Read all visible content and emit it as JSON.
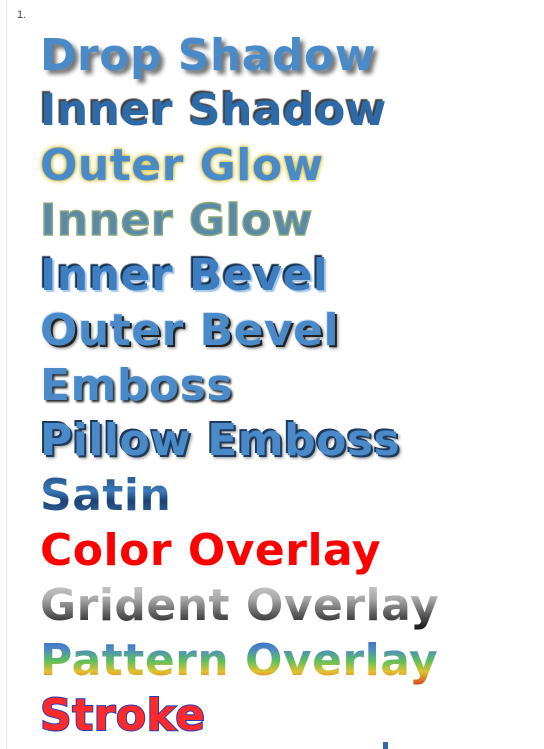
{
  "list": {
    "marker": "1."
  },
  "effects": [
    {
      "label": "Drop Shadow",
      "color": "#4a8ac8"
    },
    {
      "label": "Inner Shadow",
      "color": "#2f6aa8"
    },
    {
      "label": "Outer Glow",
      "color": "#4a8ac8"
    },
    {
      "label": "Inner Glow",
      "color": "#5b8aa8"
    },
    {
      "label": "Inner Bevel",
      "color": "#3e7ec0"
    },
    {
      "label": "Outer Bevel",
      "color": "#4a8ac8"
    },
    {
      "label": "Emboss",
      "color": "#4a8ac8"
    },
    {
      "label": "Pillow Emboss",
      "color": "#4a8ac8"
    },
    {
      "label": "Satin",
      "color": "#2b5f98"
    },
    {
      "label": "Color Overlay",
      "color": "#ff0000"
    },
    {
      "label": "Grident Overlay",
      "color": "#777777"
    },
    {
      "label": "Pattern Overlay",
      "color": "#5dbf5d"
    },
    {
      "label": "Stroke",
      "color": "#ff2a2a"
    }
  ]
}
